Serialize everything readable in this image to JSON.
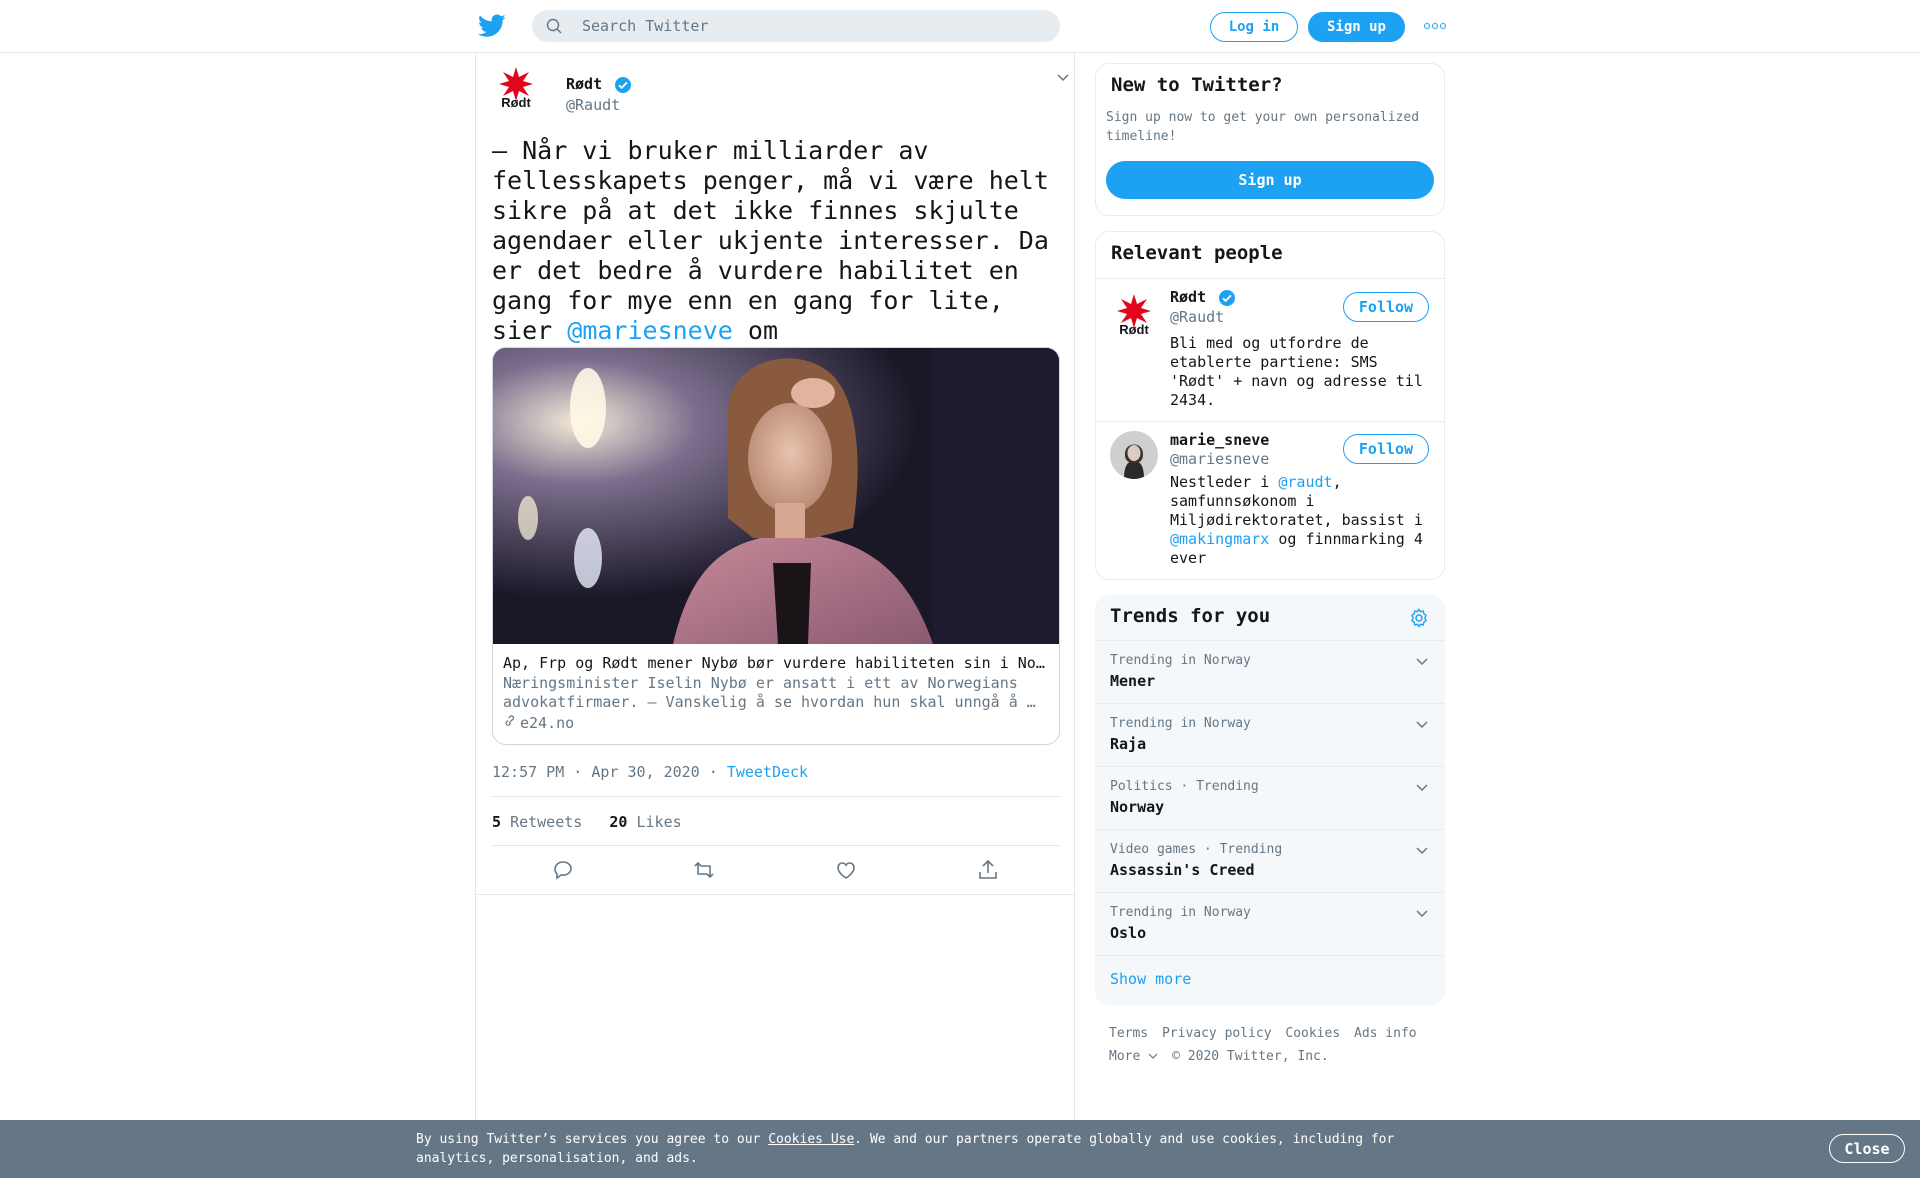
{
  "header": {
    "search_placeholder": "Search Twitter",
    "login_label": "Log in",
    "signup_label": "Sign up",
    "more_icon": "more-dots-icon"
  },
  "tweet": {
    "author_name": "Rødt",
    "author_handle": "@Raudt",
    "avatar_text": "Rødt",
    "text_before": "– Når vi bruker milliarder av fellesskapets penger, må vi være helt sikre på at det ikke finnes skjulte agendaer eller ukjente interesser. Da er det bedre å vurdere habilitet en gang for mye enn en gang for lite, sier ",
    "text_link": "@mariesneve",
    "text_after": " om næringsministeren.",
    "card": {
      "title": "Ap, Frp og Rødt mener Nybø bør vurdere habiliteten sin i Norwegian-saken",
      "description": "Næringsminister Iselin Nybø er ansatt i ett av Norwegians advokatfirmaer. – Vanskelig å se hvordan hun skal unngå å …",
      "domain": "e24.no"
    },
    "time": "12:57 PM · Apr 30, 2020",
    "separator": "·",
    "source": "TweetDeck",
    "retweets_count": "5",
    "retweets_label": "Retweets",
    "likes_count": "20",
    "likes_label": "Likes"
  },
  "signup_panel": {
    "title": "New to Twitter?",
    "description": "Sign up now to get your own personalized timeline!",
    "button": "Sign up"
  },
  "relevant_people": {
    "title": "Relevant people",
    "people": [
      {
        "name": "Rødt",
        "handle": "@Raudt",
        "bio": "Bli med og utfordre de etablerte partiene: SMS 'Rødt' + navn og adresse til 2434.",
        "follow": "Follow"
      },
      {
        "name": "marie_sneve",
        "handle": "@mariesneve",
        "bio_1": "Nestleder i ",
        "bio_link1": "@raudt",
        "bio_2": ", samfunnsøkonom i Miljødirektoratet, bassist i ",
        "bio_link2": "@makingmarx",
        "bio_3": " og finnmarking 4 ever",
        "follow": "Follow"
      }
    ]
  },
  "trends": {
    "title": "Trends for you",
    "items": [
      {
        "context": "Trending in Norway",
        "name": "Mener"
      },
      {
        "context": "Trending in Norway",
        "name": "Raja"
      },
      {
        "context": "Politics · Trending",
        "name": "Norway"
      },
      {
        "context": "Video games · Trending",
        "name": "Assassin's Creed"
      },
      {
        "context": "Trending in Norway",
        "name": "Oslo"
      }
    ],
    "show_more": "Show more"
  },
  "footer": {
    "links": [
      "Terms",
      "Privacy policy",
      "Cookies",
      "Ads info"
    ],
    "more": "More",
    "copyright": "© 2020 Twitter, Inc."
  },
  "cookie_bar": {
    "text_before": "By using Twitter’s services you agree to our ",
    "link": "Cookies Use",
    "text_after": ". We and our partners operate globally and use cookies, including for analytics, personalisation, and ads.",
    "close": "Close"
  },
  "colors": {
    "accent": "#1da1f2",
    "text": "#14171a",
    "secondary": "#657786",
    "border": "#e1e8ed",
    "cookie_bg": "#657786",
    "rodt_red": "#e3051b"
  }
}
